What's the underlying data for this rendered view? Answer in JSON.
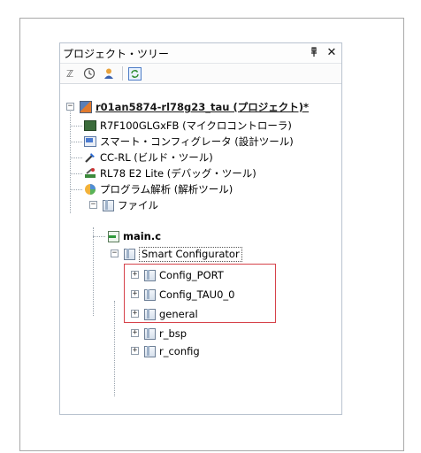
{
  "panel": {
    "title": "プロジェクト・ツリー",
    "pin_glyph": "ᵽ",
    "close_glyph": "✕"
  },
  "tree": {
    "project": "r01an5874-rl78g23_tau (プロジェクト)*",
    "device": "R7F100GLGxFB (マイクロコントローラ)",
    "smart_config_tool": "スマート・コンフィグレータ (設計ツール)",
    "compiler": "CC-RL (ビルド・ツール)",
    "debugger": "RL78 E2 Lite (デバッグ・ツール)",
    "analyzer": "プログラム解析 (解析ツール)",
    "files_folder": "ファイル",
    "main_file": "main.c",
    "smart_configurator_folder": "Smart Configurator",
    "subfolders": [
      "Config_PORT",
      "Config_TAU0_0",
      "general",
      "r_bsp",
      "r_config"
    ]
  },
  "colors": {
    "highlight_border": "#d6424a"
  }
}
